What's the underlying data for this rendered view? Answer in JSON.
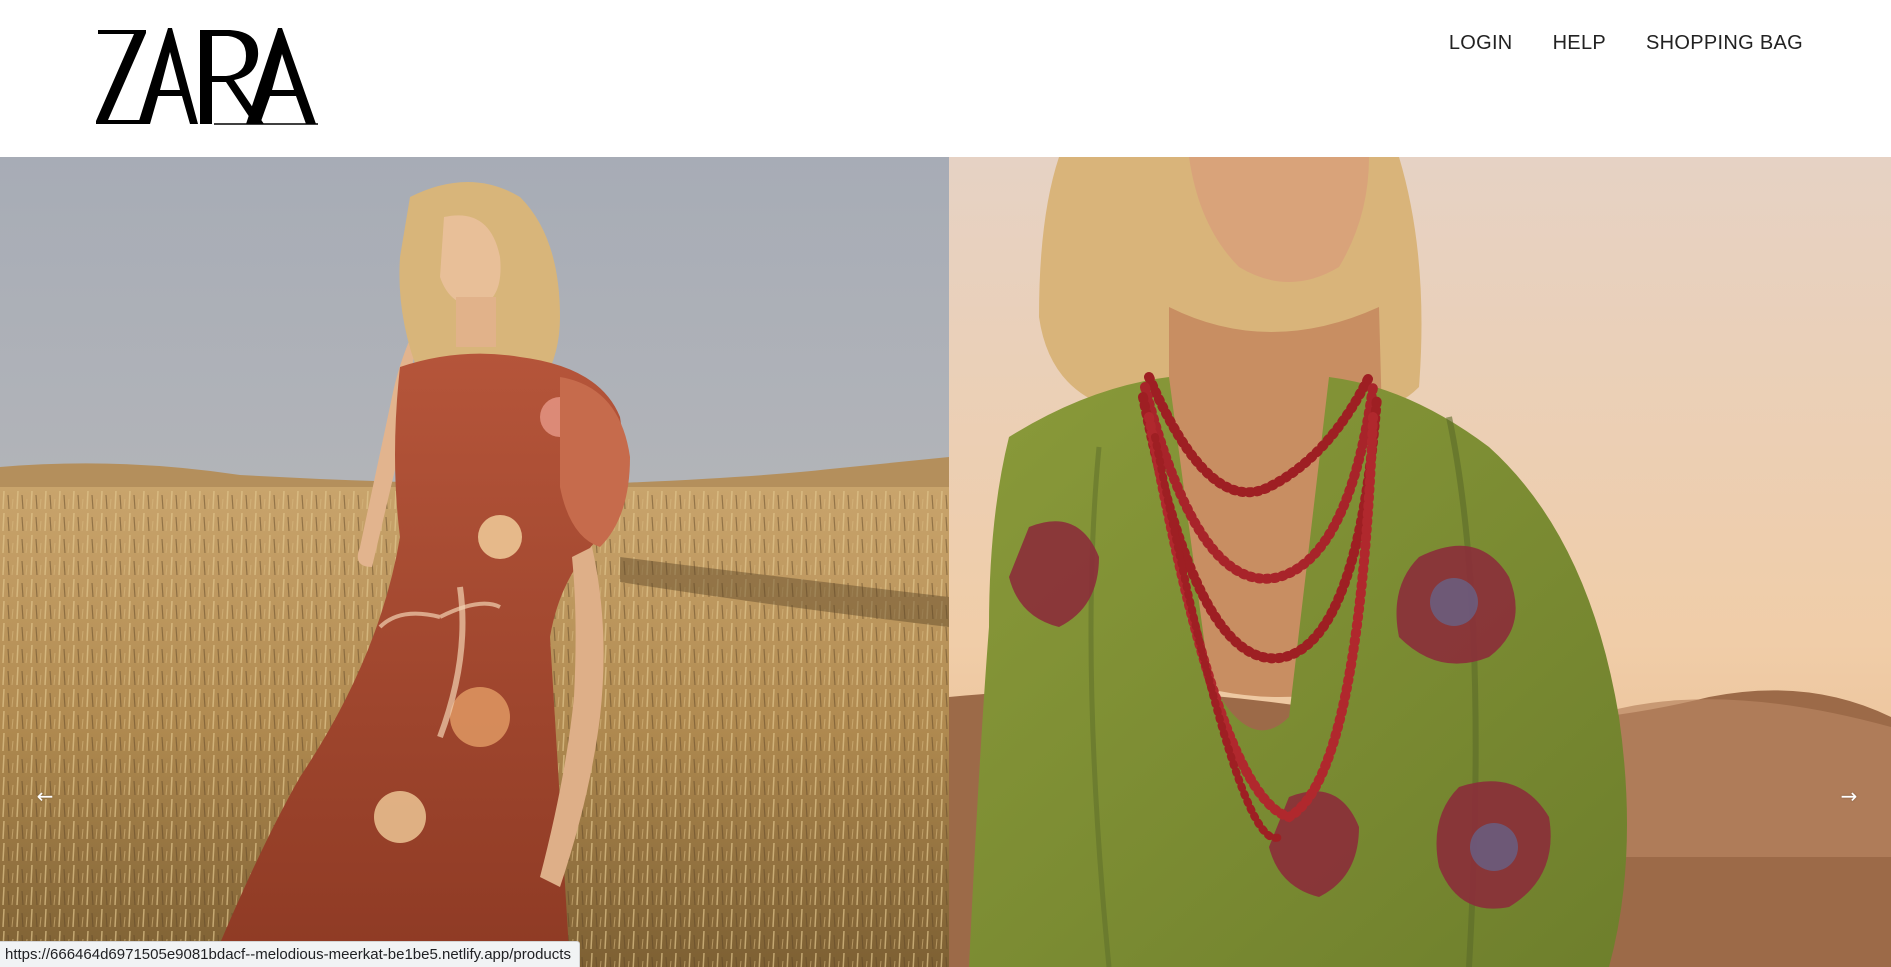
{
  "brand": {
    "logo_text": "ZARA",
    "logo_color": "#000000"
  },
  "nav": {
    "items": [
      {
        "label": "LOGIN"
      },
      {
        "label": "HELP"
      },
      {
        "label": "SHOPPING BAG"
      }
    ]
  },
  "carousel": {
    "prev_icon": "arrow-left-icon",
    "next_icon": "arrow-right-icon",
    "prev_glyph": "←",
    "next_glyph": "→",
    "slides": [
      {
        "subject": "model-in-floral-dress-wheat-field"
      },
      {
        "subject": "model-in-green-blouse-red-beads"
      }
    ]
  },
  "status_bar": {
    "url": "https://666464d6971505e9081bdacf--melodious-meerkat-be1be5.netlify.app/products"
  }
}
